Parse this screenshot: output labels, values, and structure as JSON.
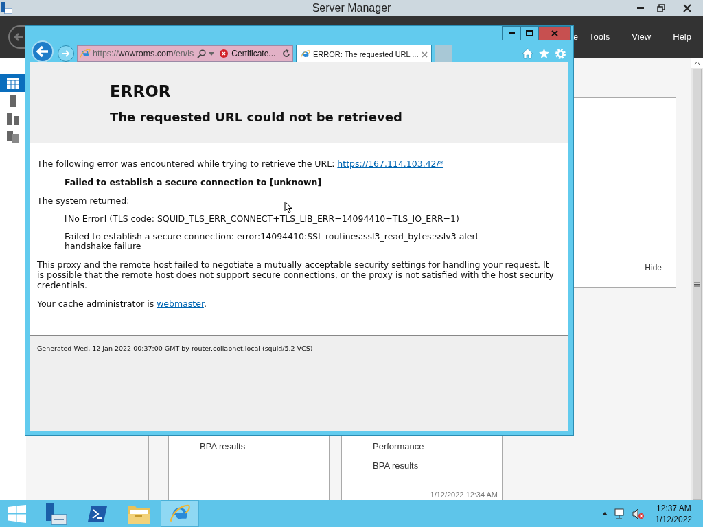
{
  "server_manager": {
    "title": "Server Manager",
    "menu": [
      "e",
      "Tools",
      "View",
      "Help"
    ],
    "sidebar": [
      {
        "kind": "dashboard",
        "selected": true
      },
      {
        "kind": "server",
        "selected": false
      },
      {
        "kind": "servers",
        "selected": false
      },
      {
        "kind": "roles",
        "selected": false
      }
    ],
    "tile": {
      "hide_link": "Hide"
    },
    "cards": [
      {
        "items": [
          "BPA results"
        ]
      },
      {
        "items": [
          "Performance",
          "BPA results"
        ],
        "timestamp": "1/12/2022 12:34 AM"
      }
    ]
  },
  "browser": {
    "address": {
      "scheme": "https://",
      "host": "wowroms.com",
      "path": "/en/is",
      "certificate": "Certificate..."
    },
    "tabs": [
      {
        "label": "ERROR: The requested URL ...",
        "selected": true
      }
    ],
    "page": {
      "title": "ERROR",
      "subtitle": "The requested URL could not be retrieved",
      "blocks": [
        {
          "kind": "text",
          "text": "The following error was encountered while trying to retrieve the URL: ",
          "link": "https://167.114.103.42/*"
        },
        {
          "kind": "strong",
          "text": "Failed to establish a secure connection to [unknown]"
        },
        {
          "kind": "text",
          "text": "The system returned:"
        },
        {
          "kind": "indent",
          "text": "[No Error] (TLS code: SQUID_TLS_ERR_CONNECT+TLS_LIB_ERR=14094410+TLS_IO_ERR=1)"
        },
        {
          "kind": "indent",
          "text": "Failed to establish a secure connection: error:14094410:SSL routines:ssl3_read_bytes:sslv3 alert handshake failure"
        },
        {
          "kind": "text",
          "text": "This proxy and the remote host failed to negotiate a mutually acceptable security settings for handling your request. It is possible that the remote host does not support secure connections, or the proxy is not satisfied with the host security credentials."
        },
        {
          "kind": "text",
          "text": "Your cache administrator is ",
          "link": "webmaster",
          "after": "."
        }
      ],
      "footer": "Generated Wed, 12 Jan 2022 00:37:00 GMT by router.collabnet.local (squid/5.2-VCS)"
    }
  },
  "taskbar": {
    "apps": [
      {
        "kind": "server-manager",
        "selected": false
      },
      {
        "kind": "powershell",
        "selected": false
      },
      {
        "kind": "explorer",
        "selected": false
      },
      {
        "kind": "ie",
        "selected": true
      }
    ],
    "clock": {
      "time": "12:37 AM",
      "date": "1/12/2022"
    }
  }
}
